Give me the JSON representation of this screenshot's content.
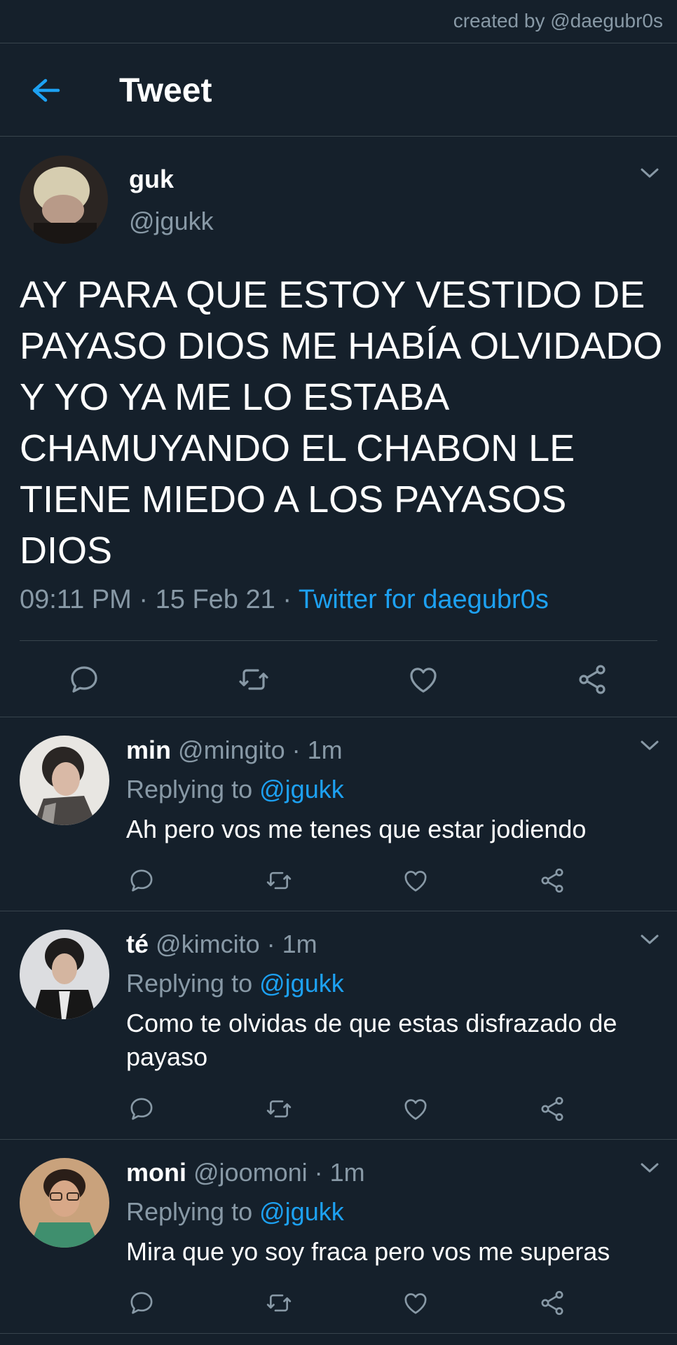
{
  "credit": "created by @daegubr0s",
  "header": {
    "title": "Tweet"
  },
  "tweet": {
    "name": "guk",
    "handle": "@jgukk",
    "text": "AY PARA QUE ESTOY VESTIDO DE PAYASO DIOS ME HABÍA OLVIDADO Y YO YA ME LO ESTABA CHAMUYANDO EL CHABON LE TIENE MIEDO A LOS PAYASOS DIOS",
    "time": "09:11 PM",
    "date": "15 Feb 21",
    "source": "Twitter for daegubr0s"
  },
  "replies": [
    {
      "name": "min",
      "handle": "@mingito",
      "time": "1m",
      "replying_label": "Replying to",
      "replying_to": "@jgukk",
      "text": "Ah pero vos me tenes que estar jodiendo"
    },
    {
      "name": "té",
      "handle": "@kimcito",
      "time": "1m",
      "replying_label": "Replying to",
      "replying_to": "@jgukk",
      "text": "Como te olvidas de que estas disfrazado de payaso"
    },
    {
      "name": "moni",
      "handle": "@joomoni",
      "time": "1m",
      "replying_label": "Replying to",
      "replying_to": "@jgukk",
      "text": "Mira que yo soy fraca pero vos me superas"
    }
  ],
  "icons": {
    "back": "arrow-left-icon",
    "caret": "chevron-down-icon",
    "reply": "reply-icon",
    "retweet": "retweet-icon",
    "like": "heart-icon",
    "share": "share-icon"
  },
  "colors": {
    "background": "#15202b",
    "accent": "#1da1f2",
    "muted": "#8899a6",
    "divider": "#38444d"
  }
}
